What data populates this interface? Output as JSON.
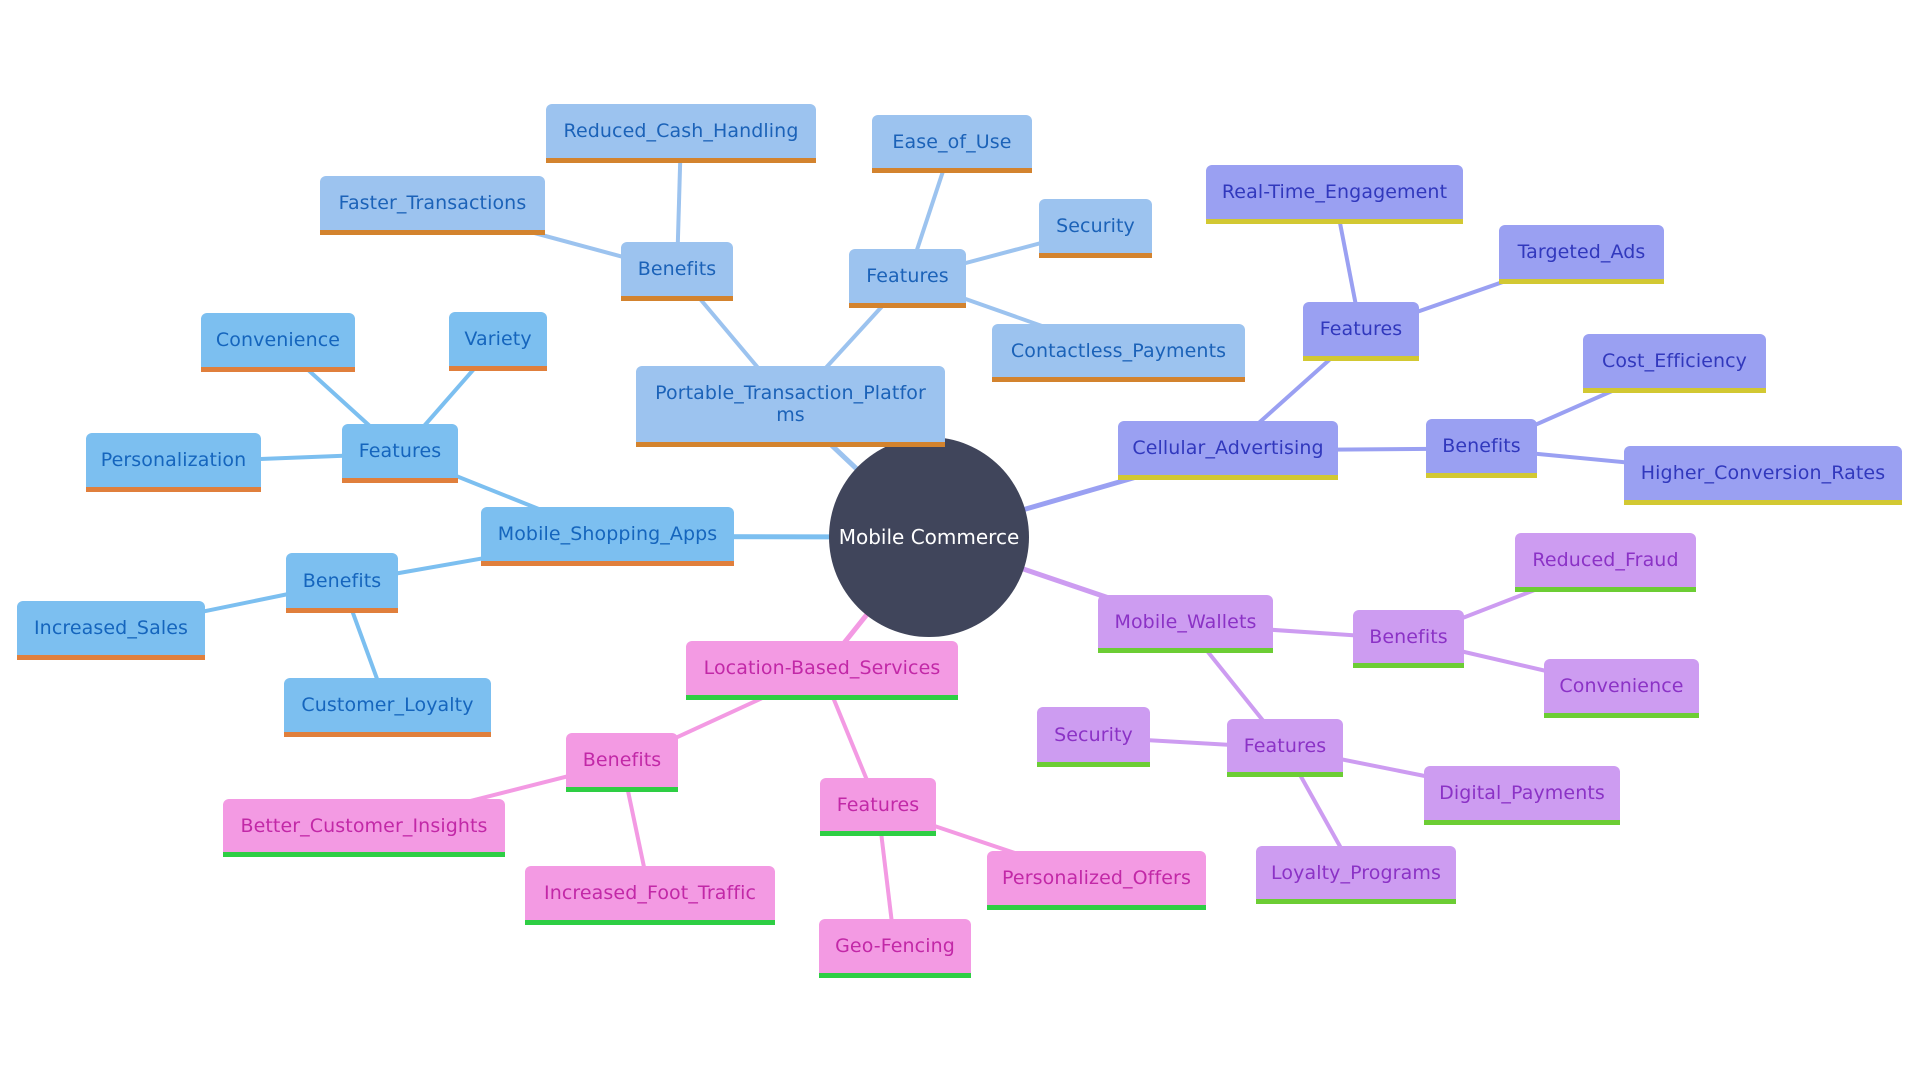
{
  "diagram": {
    "type": "mindmap",
    "root": {
      "id": "root",
      "label": "Mobile Commerce",
      "color": "#40455b"
    },
    "branch_colors": {
      "mobile_shopping_apps": {
        "fill": "#7cbff0",
        "text": "#1565bd",
        "underline": "#e07f3c",
        "edge": "#7cbff0"
      },
      "portable_transaction_platforms": {
        "fill": "#9cc3ef",
        "text": "#1b62b8",
        "underline": "#d3832e",
        "edge": "#9cc3ef"
      },
      "cellular_advertising": {
        "fill": "#9aa0f2",
        "text": "#3138bd",
        "underline": "#d2c832",
        "edge": "#9aa0f2"
      },
      "mobile_wallets": {
        "fill": "#cd9cf1",
        "text": "#8b32c6",
        "underline": "#6ccd34",
        "edge": "#cd9cf1"
      },
      "location_based_services": {
        "fill": "#f39ae3",
        "text": "#c228a7",
        "underline": "#2ece44",
        "edge": "#f39ae3"
      }
    },
    "nodes": [
      {
        "id": "msa",
        "label": "Mobile_Shopping_Apps",
        "parent": "root",
        "branch": "mobile_shopping_apps"
      },
      {
        "id": "msa_features",
        "label": "Features",
        "parent": "msa",
        "branch": "mobile_shopping_apps"
      },
      {
        "id": "msa_f_convenience",
        "label": "Convenience",
        "parent": "msa_features",
        "branch": "mobile_shopping_apps"
      },
      {
        "id": "msa_f_variety",
        "label": "Variety",
        "parent": "msa_features",
        "branch": "mobile_shopping_apps"
      },
      {
        "id": "msa_f_personalization",
        "label": "Personalization",
        "parent": "msa_features",
        "branch": "mobile_shopping_apps"
      },
      {
        "id": "msa_benefits",
        "label": "Benefits",
        "parent": "msa",
        "branch": "mobile_shopping_apps"
      },
      {
        "id": "msa_b_sales",
        "label": "Increased_Sales",
        "parent": "msa_benefits",
        "branch": "mobile_shopping_apps"
      },
      {
        "id": "msa_b_loyalty",
        "label": "Customer_Loyalty",
        "parent": "msa_benefits",
        "branch": "mobile_shopping_apps"
      },
      {
        "id": "ptp",
        "label": "Portable_Transaction_Platfor ms",
        "parent": "root",
        "branch": "portable_transaction_platforms"
      },
      {
        "id": "ptp_benefits",
        "label": "Benefits",
        "parent": "ptp",
        "branch": "portable_transaction_platforms"
      },
      {
        "id": "ptp_b_cash",
        "label": "Reduced_Cash_Handling",
        "parent": "ptp_benefits",
        "branch": "portable_transaction_platforms"
      },
      {
        "id": "ptp_b_faster",
        "label": "Faster_Transactions",
        "parent": "ptp_benefits",
        "branch": "portable_transaction_platforms"
      },
      {
        "id": "ptp_features",
        "label": "Features",
        "parent": "ptp",
        "branch": "portable_transaction_platforms"
      },
      {
        "id": "ptp_f_ease",
        "label": "Ease_of_Use",
        "parent": "ptp_features",
        "branch": "portable_transaction_platforms"
      },
      {
        "id": "ptp_f_security",
        "label": "Security",
        "parent": "ptp_features",
        "branch": "portable_transaction_platforms"
      },
      {
        "id": "ptp_f_contactless",
        "label": "Contactless_Payments",
        "parent": "ptp_features",
        "branch": "portable_transaction_platforms"
      },
      {
        "id": "ca",
        "label": "Cellular_Advertising",
        "parent": "root",
        "branch": "cellular_advertising"
      },
      {
        "id": "ca_features",
        "label": "Features",
        "parent": "ca",
        "branch": "cellular_advertising"
      },
      {
        "id": "ca_f_realtime",
        "label": "Real-Time_Engagement",
        "parent": "ca_features",
        "branch": "cellular_advertising"
      },
      {
        "id": "ca_f_targeted",
        "label": "Targeted_Ads",
        "parent": "ca_features",
        "branch": "cellular_advertising"
      },
      {
        "id": "ca_benefits",
        "label": "Benefits",
        "parent": "ca",
        "branch": "cellular_advertising"
      },
      {
        "id": "ca_b_cost",
        "label": "Cost_Efficiency",
        "parent": "ca_benefits",
        "branch": "cellular_advertising"
      },
      {
        "id": "ca_b_conversion",
        "label": "Higher_Conversion_Rates",
        "parent": "ca_benefits",
        "branch": "cellular_advertising"
      },
      {
        "id": "mw",
        "label": "Mobile_Wallets",
        "parent": "root",
        "branch": "mobile_wallets"
      },
      {
        "id": "mw_benefits",
        "label": "Benefits",
        "parent": "mw",
        "branch": "mobile_wallets"
      },
      {
        "id": "mw_b_fraud",
        "label": "Reduced_Fraud",
        "parent": "mw_benefits",
        "branch": "mobile_wallets"
      },
      {
        "id": "mw_b_convenience",
        "label": "Convenience",
        "parent": "mw_benefits",
        "branch": "mobile_wallets"
      },
      {
        "id": "mw_features",
        "label": "Features",
        "parent": "mw",
        "branch": "mobile_wallets"
      },
      {
        "id": "mw_f_security",
        "label": "Security",
        "parent": "mw_features",
        "branch": "mobile_wallets"
      },
      {
        "id": "mw_f_digital",
        "label": "Digital_Payments",
        "parent": "mw_features",
        "branch": "mobile_wallets"
      },
      {
        "id": "mw_f_loyalty",
        "label": "Loyalty_Programs",
        "parent": "mw_features",
        "branch": "mobile_wallets"
      },
      {
        "id": "lbs",
        "label": "Location-Based_Services",
        "parent": "root",
        "branch": "location_based_services"
      },
      {
        "id": "lbs_benefits",
        "label": "Benefits",
        "parent": "lbs",
        "branch": "location_based_services"
      },
      {
        "id": "lbs_b_insights",
        "label": "Better_Customer_Insights",
        "parent": "lbs_benefits",
        "branch": "location_based_services"
      },
      {
        "id": "lbs_b_foot",
        "label": "Increased_Foot_Traffic",
        "parent": "lbs_benefits",
        "branch": "location_based_services"
      },
      {
        "id": "lbs_features",
        "label": "Features",
        "parent": "lbs",
        "branch": "location_based_services"
      },
      {
        "id": "lbs_f_offers",
        "label": "Personalized_Offers",
        "parent": "lbs_features",
        "branch": "location_based_services"
      },
      {
        "id": "lbs_f_geofencing",
        "label": "Geo-Fencing",
        "parent": "lbs_features",
        "branch": "location_based_services"
      }
    ]
  }
}
